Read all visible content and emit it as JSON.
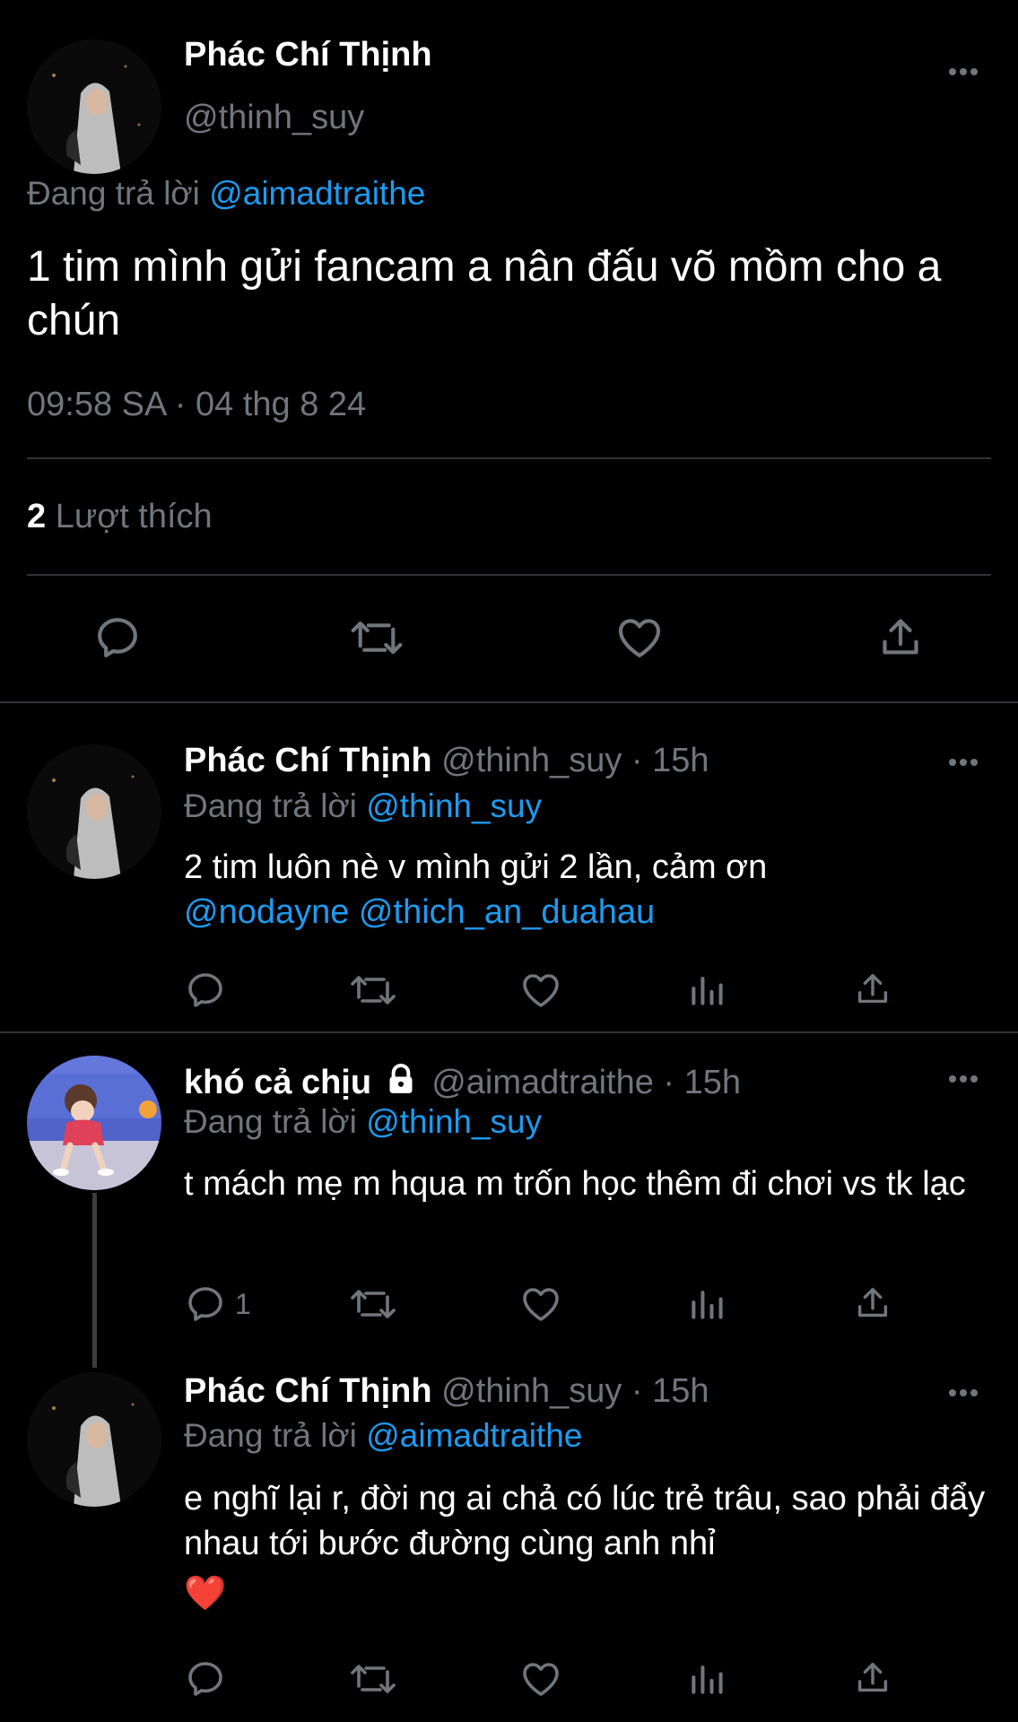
{
  "main_tweet": {
    "author_name": "Phác Chí Thịnh",
    "author_handle": "@thinh_suy",
    "reply_prefix": "Đang trả lời",
    "reply_to": "@aimadtraithe",
    "text": "1 tim mình gửi fancam a nân đấu võ mồm cho a chún",
    "timestamp": "09:58 SA · 04 thg 8 24",
    "likes_count": "2",
    "likes_label": "Lượt thích",
    "actions": [
      "reply-icon",
      "retweet-icon",
      "heart-icon",
      "share-icon"
    ]
  },
  "replies": [
    {
      "author_name": "Phác Chí Thịnh",
      "author_handle": "@thinh_suy · 15h",
      "reply_prefix": "Đang trả lời",
      "reply_to": "@thinh_suy",
      "text": "2 tim luôn nè v mình gửi 2 lần, cảm ơn",
      "mentions": "@nodayne @thich_an_duahau",
      "reply_count": ""
    },
    {
      "author_name": "khó cả chịu",
      "author_handle": "@aimadtraithe · 15h",
      "reply_prefix": "Đang trả lời",
      "reply_to": "@thinh_suy",
      "text": "t mách mẹ m hqua m trốn học thêm đi chơi vs tk lạc",
      "reply_count": "1",
      "locked": true
    },
    {
      "author_name": "Phác Chí Thịnh",
      "author_handle": "@thinh_suy · 15h",
      "reply_prefix": "Đang trả lời",
      "reply_to": "@aimadtraithe",
      "text": "e nghĩ lại r, đời ng ai chả có lúc trẻ trâu, sao phải đẩy nhau tới bước đường cùng anh nhỉ",
      "emoji": "❤️",
      "reply_count": ""
    }
  ],
  "colors": {
    "background": "#000000",
    "text": "#e7e9ea",
    "muted": "#71767b",
    "link": "#1d9bf0",
    "divider": "#2f3336"
  }
}
